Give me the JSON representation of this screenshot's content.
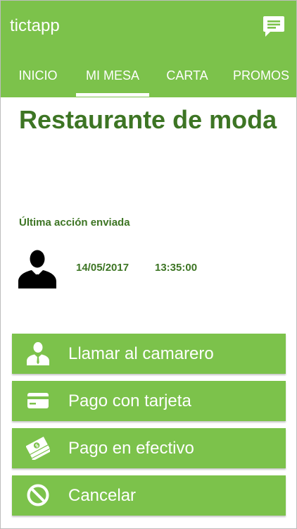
{
  "app": {
    "title": "tictapp",
    "brand_color": "#7cc24b",
    "text_color": "#3d7524"
  },
  "header": {
    "chat_icon": "chat-bubble-icon"
  },
  "tabs": [
    {
      "label": "INICIO",
      "active": false
    },
    {
      "label": "MI MESA",
      "active": true
    },
    {
      "label": "CARTA",
      "active": false
    },
    {
      "label": "PROMOS",
      "active": false
    }
  ],
  "main": {
    "title": "Restaurante de moda",
    "last_action_label": "Última acción enviada",
    "last_action_icon": "waiter-icon",
    "last_action_date": "14/05/2017",
    "last_action_time": "13:35:00"
  },
  "actions": [
    {
      "label": "Llamar al camarero",
      "icon": "waiter-icon"
    },
    {
      "label": "Pago con tarjeta",
      "icon": "credit-card-icon"
    },
    {
      "label": "Pago en efectivo",
      "icon": "cash-icon"
    },
    {
      "label": "Cancelar",
      "icon": "cancel-icon"
    }
  ]
}
